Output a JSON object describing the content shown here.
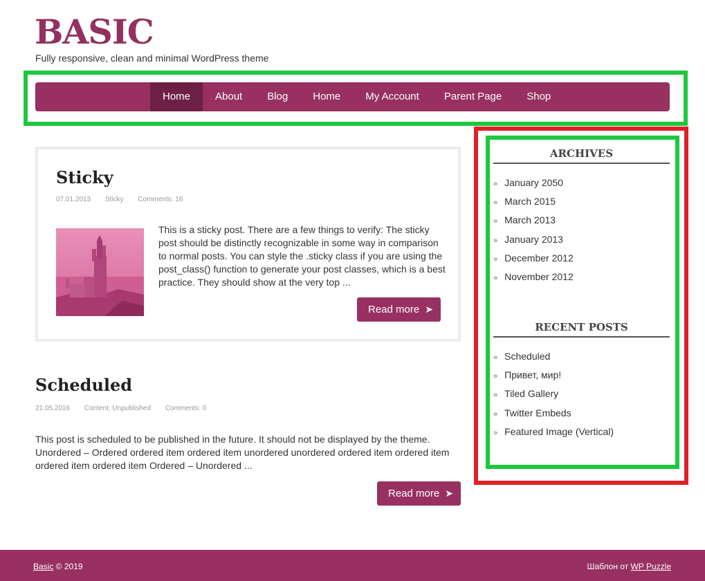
{
  "site": {
    "title": "BASIC",
    "description": "Fully responsive, clean and minimal WordPress theme"
  },
  "nav": {
    "items": [
      {
        "label": "Home",
        "active": true
      },
      {
        "label": "About"
      },
      {
        "label": "Blog"
      },
      {
        "label": "Home"
      },
      {
        "label": "My Account"
      },
      {
        "label": "Parent Page"
      },
      {
        "label": "Shop"
      }
    ]
  },
  "posts": [
    {
      "title": "Sticky",
      "date": "07.01.2013",
      "category": "Sticky",
      "comments": "Comments: 16",
      "excerpt": "This is a sticky post. There are a few things to verify: The sticky post should be distinctly recognizable in some way in comparison to normal posts. You can style the .sticky class if you are using the post_class() function to generate your post classes, which is a best practice. They should show at the very top ...",
      "read_more": "Read more"
    },
    {
      "title": "Scheduled",
      "date": "21.05.2016",
      "category": "Content, Unpublished",
      "comments": "Comments: 0",
      "excerpt": "This post is scheduled to be published in the future. It should not be displayed by the theme. Unordered – Ordered ordered item ordered item unordered unordered ordered item ordered item ordered item ordered item Ordered – Unordered ...",
      "read_more": "Read more"
    }
  ],
  "sidebar": {
    "archives": {
      "title": "ARCHIVES",
      "items": [
        "January 2050",
        "March 2015",
        "March 2013",
        "January 2013",
        "December 2012",
        "November 2012"
      ]
    },
    "recent_posts": {
      "title": "RECENT POSTS",
      "items": [
        "Scheduled",
        "Привет, мир!",
        "Tiled Gallery",
        "Twitter Embeds",
        "Featured Image (Vertical)"
      ]
    },
    "bullet": "»"
  },
  "footer": {
    "left_link": "Basic",
    "left_text": " © 2019",
    "right_text": "Шаблон от ",
    "right_link": "WP Puzzle"
  },
  "colors": {
    "brand": "#983061",
    "nav_active": "#6e1f45",
    "annotation_green": "#1dc83e",
    "annotation_red": "#e11f26"
  }
}
